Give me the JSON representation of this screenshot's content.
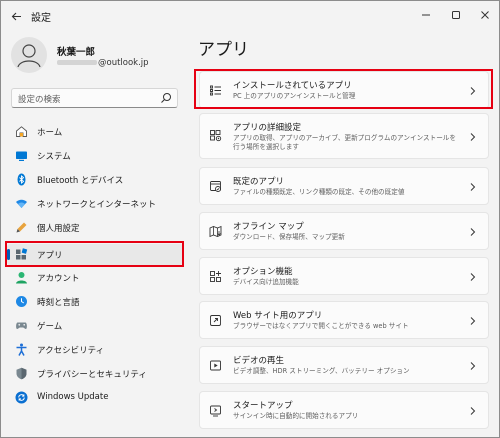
{
  "window": {
    "title": "設定",
    "controls": [
      "minimize-icon",
      "maximize-icon",
      "close-icon"
    ]
  },
  "profile": {
    "name": "秋葉一郎",
    "email_suffix": "@outlook.jp"
  },
  "search": {
    "placeholder": "設定の検索"
  },
  "sidebar": {
    "items": [
      {
        "label": "ホーム",
        "icon": "home-icon"
      },
      {
        "label": "システム",
        "icon": "system-icon"
      },
      {
        "label": "Bluetooth とデバイス",
        "icon": "bluetooth-icon"
      },
      {
        "label": "ネットワークとインターネット",
        "icon": "network-icon"
      },
      {
        "label": "個人用設定",
        "icon": "personalization-icon"
      },
      {
        "label": "アプリ",
        "icon": "apps-icon",
        "selected": true
      },
      {
        "label": "アカウント",
        "icon": "account-icon"
      },
      {
        "label": "時刻と言語",
        "icon": "time-language-icon"
      },
      {
        "label": "ゲーム",
        "icon": "gaming-icon"
      },
      {
        "label": "アクセシビリティ",
        "icon": "accessibility-icon"
      },
      {
        "label": "プライバシーとセキュリティ",
        "icon": "privacy-icon"
      },
      {
        "label": "Windows Update",
        "icon": "windows-update-icon"
      }
    ]
  },
  "main": {
    "title": "アプリ",
    "cards": [
      {
        "title": "インストールされているアプリ",
        "desc": "PC 上のアプリのアンインストールと管理",
        "icon": "installed-apps-icon"
      },
      {
        "title": "アプリの詳細設定",
        "desc": "アプリの取得、アプリのアーカイブ、更新プログラムのアンインストールを行う場所を選択します",
        "icon": "advanced-apps-icon"
      },
      {
        "title": "既定のアプリ",
        "desc": "ファイルの種類既定、リンク種類の既定、その他の既定値",
        "icon": "default-apps-icon"
      },
      {
        "title": "オフライン マップ",
        "desc": "ダウンロード、保存場所、マップ更新",
        "icon": "offline-maps-icon"
      },
      {
        "title": "オプション機能",
        "desc": "デバイス向け追加機能",
        "icon": "optional-features-icon"
      },
      {
        "title": "Web サイト用のアプリ",
        "desc": "ブラウザーではなくアプリで開くことができる web サイト",
        "icon": "apps-for-websites-icon"
      },
      {
        "title": "ビデオの再生",
        "desc": "ビデオ調整、HDR ストリーミング、バッテリー オプション",
        "icon": "video-playback-icon"
      },
      {
        "title": "スタートアップ",
        "desc": "サインイン時に自動的に開始されるアプリ",
        "icon": "startup-icon"
      }
    ]
  },
  "colors": {
    "accent": "#005fb8",
    "highlight": "#e60012",
    "background": "#f3f3f3",
    "card": "#fbfbfb"
  }
}
